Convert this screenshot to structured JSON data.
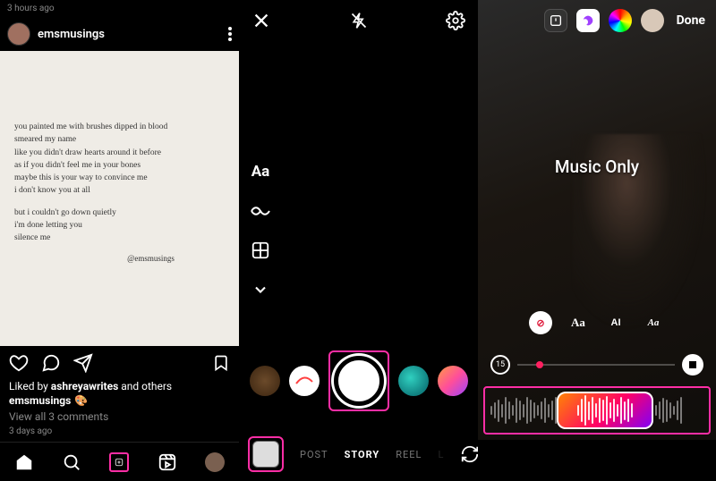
{
  "panel1": {
    "top_timestamp": "3 hours ago",
    "username": "emsmusings",
    "poem_lines_1": [
      "you painted me with brushes dipped in blood",
      "smeared my name",
      "like you didn't draw hearts around it before",
      "as if you didn't feel me in your bones",
      "maybe this is your way to convince me",
      "i don't know you at all"
    ],
    "poem_lines_2": [
      "but i couldn't go down quietly",
      "i'm done letting you",
      "silence me"
    ],
    "poem_signature": "@emsmusings",
    "liked_by_prefix": "Liked by ",
    "liked_by_user": "ashreyawrites",
    "liked_by_suffix": " and others",
    "caption_user": "emsmusings",
    "caption_text": "🎨",
    "view_comments": "View all 3 comments",
    "post_age": "3 days ago",
    "nav": {
      "home": "home-icon",
      "search": "search-icon",
      "create": "plus-icon",
      "reels": "reels-icon",
      "profile": "profile-avatar"
    }
  },
  "panel2": {
    "side_tools": [
      "Aa",
      "infinity-icon",
      "layout-icon",
      "chevron-down-icon"
    ],
    "aa_label": "Aa",
    "modes": {
      "post": "POST",
      "story": "STORY",
      "reel": "REEL",
      "live_partial": "L"
    },
    "active_mode": "STORY"
  },
  "panel3": {
    "done_label": "Done",
    "overlay_label": "Music Only",
    "duration_label": "15",
    "style_pills": {
      "cancel": "⊘",
      "serif": "Aa",
      "condensed": "AI",
      "cursive": "Aa"
    },
    "accent_colors": {
      "highlight": "#ff2ea6",
      "timeline_handle": "#ff2060"
    }
  }
}
